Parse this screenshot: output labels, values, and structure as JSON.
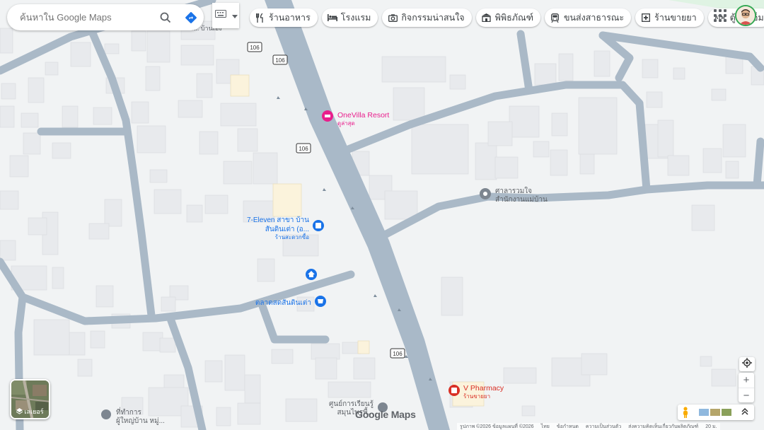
{
  "search": {
    "placeholder": "ค้นหาใน Google Maps"
  },
  "chips": [
    {
      "label": "ร้านอาหาร",
      "icon": "restaurant-icon"
    },
    {
      "label": "โรงแรม",
      "icon": "hotel-icon"
    },
    {
      "label": "กิจกรรมน่าสนใจ",
      "icon": "camera-icon"
    },
    {
      "label": "พิพิธภัณฑ์",
      "icon": "museum-icon"
    },
    {
      "label": "ขนส่งสาธารณะ",
      "icon": "transit-icon"
    },
    {
      "label": "ร้านขายยา",
      "icon": "pharmacy-icon"
    },
    {
      "label": "ตู้เอทีเอ็ม",
      "icon": "atm-icon"
    }
  ],
  "road_shields": [
    "106",
    "106",
    "106",
    "106"
  ],
  "places": {
    "onevilla": {
      "name": "OneVilla Resort",
      "sub": "ดูล่าสุด",
      "color": "#e91e8c"
    },
    "seven": {
      "name1": "7-Eleven สาขา บ้าน",
      "name2": "สันดินเต่า (อ...",
      "sub": "ร้านสะดวกซื้อ",
      "color": "#1a73e8"
    },
    "market": {
      "name": "ตลาดสดสันดินเต่า",
      "color": "#1a73e8"
    },
    "sala": {
      "name1": "ศาลารวมใจ",
      "name2": "สำนักงานแม่บ้าน",
      "color": "#5f6368"
    },
    "pharmacy": {
      "name": "V Pharmacy",
      "sub": "ร้านขายยา",
      "color": "#d93025"
    },
    "school": {
      "name1": "ศูนย์การเรียนรู้",
      "name2": "สมุนไพรพื้..."
    },
    "office": {
      "name1": "ที่ทำการ",
      "name2": "ผู้ใหญ่บ้าน หมู่..."
    },
    "top_cut": {
      "name": "...แล... บ้านเอง"
    }
  },
  "layers": {
    "label": "เลเยอร์"
  },
  "zoom": {
    "in": "+",
    "out": "−"
  },
  "logo": "Google Maps",
  "footer": [
    "รูปภาพ ©2026 ข้อมูลแผนที่ ©2026",
    "ไทย",
    "ข้อกำหนด",
    "ความเป็นส่วนตัว",
    "ส่งความคิดเห็นเกี่ยวกับผลิตภัณฑ์",
    "20 ม."
  ]
}
